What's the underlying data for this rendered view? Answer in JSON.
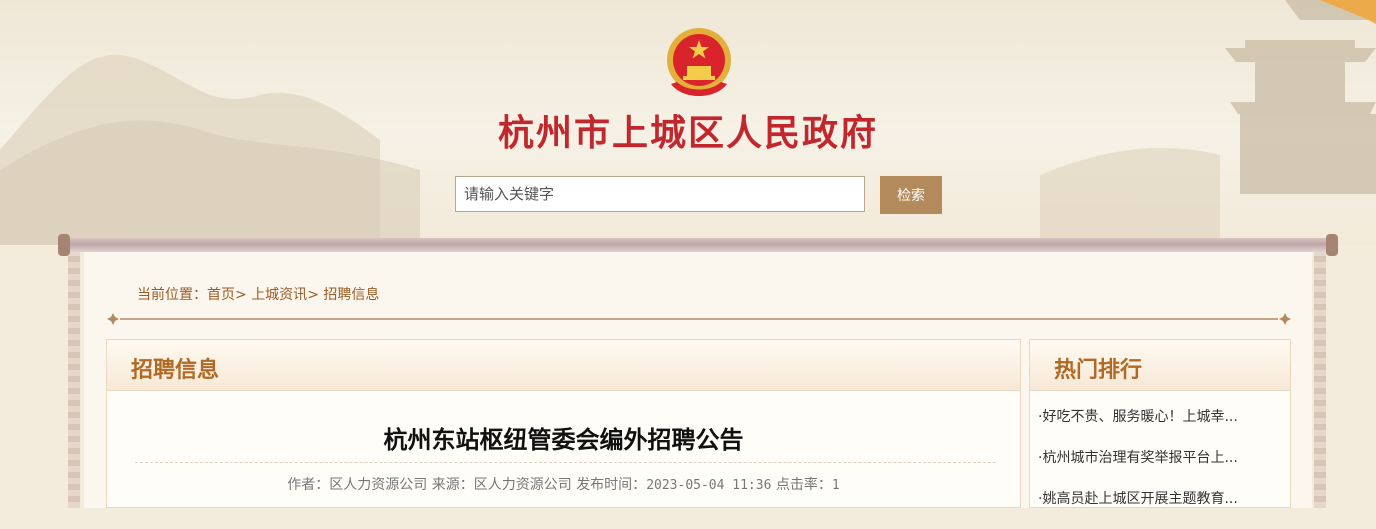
{
  "site": {
    "title": "杭州市上城区人民政府"
  },
  "search": {
    "placeholder": "请输入关键字",
    "button_label": "检索"
  },
  "breadcrumb": {
    "prefix": "当前位置：",
    "items": [
      "首页",
      "上城资讯",
      "招聘信息"
    ],
    "separator": ">"
  },
  "main_panel": {
    "heading": "招聘信息",
    "article_title": "杭州东站枢纽管委会编外招聘公告",
    "meta": {
      "author_label": "作者：",
      "author": "区人力资源公司",
      "source_label": "来源：",
      "source": "区人力资源公司",
      "time_label": "发布时间：",
      "time": "2023-05-04 11:36",
      "clicks_label": "点击率：",
      "clicks": "1"
    }
  },
  "side_panel": {
    "heading": "热门排行",
    "items": [
      "·好吃不贵、服务暖心！上城幸...",
      "·杭州城市治理有奖举报平台上...",
      "·姚高员赴上城区开展主题教育..."
    ]
  },
  "colors": {
    "title_red": "#c1272d",
    "accent_brown": "#b28a5b",
    "heading_brown": "#b06a26",
    "breadcrumb_brown": "#9c5b25",
    "page_bg": "#f3ecdd"
  },
  "icons": {
    "emblem": "national-emblem-icon",
    "divider": "ornament-divider-icon"
  }
}
